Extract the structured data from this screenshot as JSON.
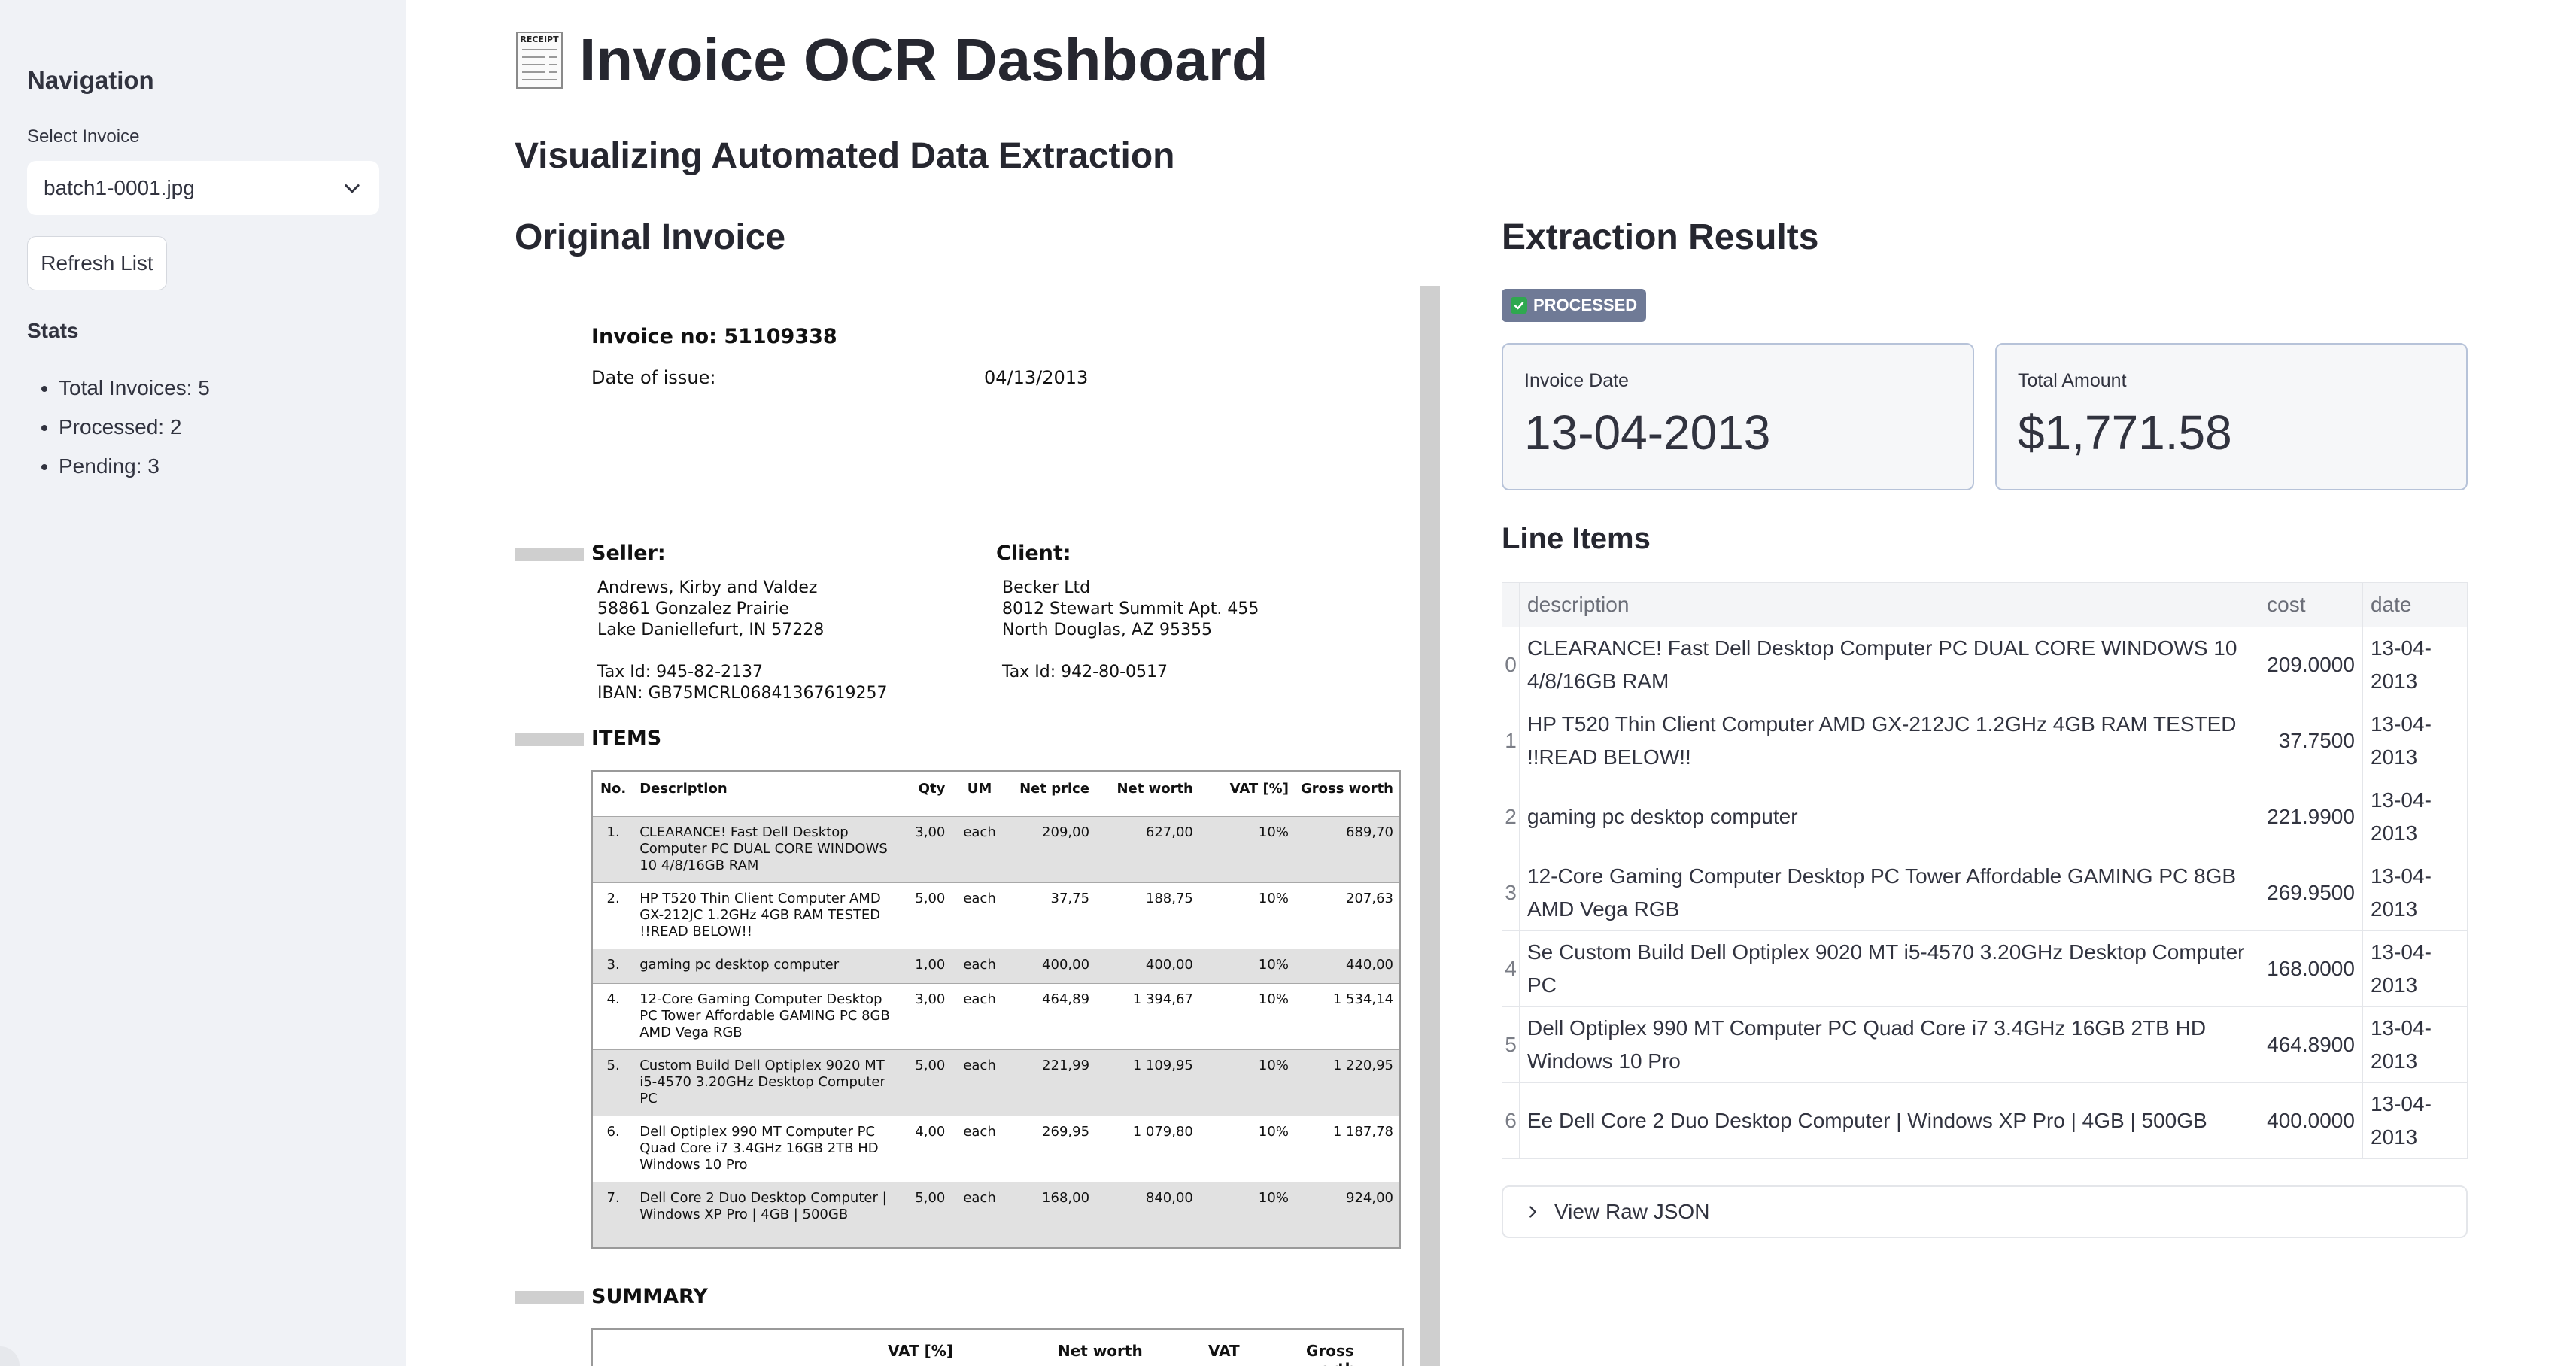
{
  "sidebar": {
    "title": "Navigation",
    "select_label": "Select Invoice",
    "select_value": "batch1-0001.jpg",
    "refresh_label": "Refresh List",
    "stats_title": "Stats",
    "stats": [
      "Total Invoices: 5",
      "Processed: 2",
      "Pending: 3"
    ]
  },
  "header": {
    "title": "Invoice OCR Dashboard",
    "subtitle": "Visualizing Automated Data Extraction",
    "receipt_icon_text": "RECEIPT"
  },
  "original": {
    "title": "Original Invoice",
    "invoice_no": "Invoice no: 51109338",
    "date_label": "Date of issue:",
    "date_value": "04/13/2013",
    "seller_heading": "Seller:",
    "seller_address": "Andrews, Kirby and Valdez\n58861 Gonzalez Prairie\nLake Daniellefurt, IN 57228\n\nTax Id: 945-82-2137\nIBAN: GB75MCRL06841367619257",
    "client_heading": "Client:",
    "client_address": "Becker Ltd\n8012 Stewart Summit Apt. 455\nNorth Douglas, AZ 95355\n\nTax Id: 942-80-0517",
    "items_heading": "ITEMS",
    "items_columns": [
      "No.",
      "Description",
      "Qty",
      "UM",
      "Net price",
      "Net worth",
      "VAT [%]",
      "Gross worth"
    ],
    "items": [
      {
        "no": "1.",
        "desc": "CLEARANCE! Fast Dell Desktop Computer PC DUAL CORE WINDOWS 10 4/8/16GB RAM",
        "qty": "3,00",
        "um": "each",
        "price": "209,00",
        "net": "627,00",
        "vat": "10%",
        "gross": "689,70"
      },
      {
        "no": "2.",
        "desc": "HP T520 Thin Client Computer AMD GX-212JC 1.2GHz 4GB RAM TESTED !!READ BELOW!!",
        "qty": "5,00",
        "um": "each",
        "price": "37,75",
        "net": "188,75",
        "vat": "10%",
        "gross": "207,63"
      },
      {
        "no": "3.",
        "desc": "gaming pc desktop computer",
        "qty": "1,00",
        "um": "each",
        "price": "400,00",
        "net": "400,00",
        "vat": "10%",
        "gross": "440,00"
      },
      {
        "no": "4.",
        "desc": "12-Core Gaming Computer Desktop PC Tower Affordable GAMING PC 8GB AMD Vega RGB",
        "qty": "3,00",
        "um": "each",
        "price": "464,89",
        "net": "1 394,67",
        "vat": "10%",
        "gross": "1 534,14"
      },
      {
        "no": "5.",
        "desc": "Custom Build Dell Optiplex 9020 MT i5-4570 3.20GHz Desktop Computer PC",
        "qty": "5,00",
        "um": "each",
        "price": "221,99",
        "net": "1 109,95",
        "vat": "10%",
        "gross": "1 220,95"
      },
      {
        "no": "6.",
        "desc": "Dell Optiplex 990 MT Computer PC Quad Core i7 3.4GHz 16GB 2TB HD Windows 10 Pro",
        "qty": "4,00",
        "um": "each",
        "price": "269,95",
        "net": "1 079,80",
        "vat": "10%",
        "gross": "1 187,78"
      },
      {
        "no": "7.",
        "desc": "Dell Core 2 Duo Desktop Computer | Windows XP Pro | 4GB | 500GB",
        "qty": "5,00",
        "um": "each",
        "price": "168,00",
        "net": "840,00",
        "vat": "10%",
        "gross": "924,00"
      }
    ],
    "summary_heading": "SUMMARY",
    "summary_columns": [
      "VAT [%]",
      "Net worth",
      "VAT",
      "Gross worth"
    ]
  },
  "results": {
    "title": "Extraction Results",
    "status": "PROCESSED",
    "invoice_date_label": "Invoice Date",
    "invoice_date_value": "13-04-2013",
    "total_label": "Total Amount",
    "total_value": "$1,771.58",
    "line_items_title": "Line Items",
    "columns": [
      "description",
      "cost",
      "date"
    ],
    "rows": [
      {
        "idx": "0",
        "description": "CLEARANCE! Fast Dell Desktop Computer PC DUAL CORE WINDOWS 10 4/8/16GB RAM",
        "cost": "209.0000",
        "date": "13-04-2013"
      },
      {
        "idx": "1",
        "description": "HP T520 Thin Client Computer AMD GX-212JC 1.2GHz 4GB RAM TESTED !!READ BELOW!!",
        "cost": "37.7500",
        "date": "13-04-2013"
      },
      {
        "idx": "2",
        "description": "gaming pc desktop computer",
        "cost": "221.9900",
        "date": "13-04-2013"
      },
      {
        "idx": "3",
        "description": "12-Core Gaming Computer Desktop PC Tower Affordable GAMING PC 8GB AMD Vega RGB",
        "cost": "269.9500",
        "date": "13-04-2013"
      },
      {
        "idx": "4",
        "description": "Se Custom Build Dell Optiplex 9020 MT i5-4570 3.20GHz Desktop Computer PC",
        "cost": "168.0000",
        "date": "13-04-2013"
      },
      {
        "idx": "5",
        "description": "Dell Optiplex 990 MT Computer PC Quad Core i7 3.4GHz 16GB 2TB HD Windows 10 Pro",
        "cost": "464.8900",
        "date": "13-04-2013"
      },
      {
        "idx": "6",
        "description": "Ee Dell Core 2 Duo Desktop Computer | Windows XP Pro | 4GB | 500GB",
        "cost": "400.0000",
        "date": "13-04-2013"
      }
    ],
    "raw_json_label": "View Raw JSON"
  },
  "colors": {
    "sidebar_bg": "#f0f2f6",
    "badge_bg": "#6f7a96",
    "metric_border": "#b7c3d9",
    "check_green": "#2fa84f"
  },
  "icons": {
    "select": "chevron-down-icon",
    "expander": "chevron-right-icon",
    "title": "receipt-icon",
    "status": "check-icon"
  }
}
